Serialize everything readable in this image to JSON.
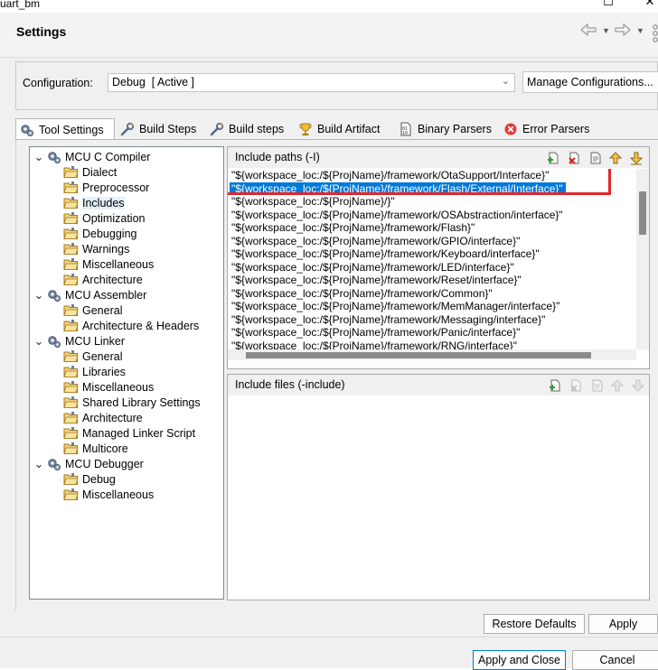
{
  "window": {
    "title": "uart_bm",
    "maximize_glyph": "☐",
    "close_glyph": "✕"
  },
  "header": {
    "title": "Settings",
    "back_icon": "back-arrow-icon",
    "forward_icon": "forward-arrow-icon",
    "menu_icon": "view-menu-icon"
  },
  "configuration": {
    "label": "Configuration:",
    "value": "Debug  [ Active ]",
    "manage_button": "Manage Configurations..."
  },
  "tabs": [
    {
      "label": "Tool Settings",
      "icon": "gears-icon",
      "active": true
    },
    {
      "label": "Build Steps",
      "icon": "wrench-icon"
    },
    {
      "label": "Build steps",
      "icon": "wrench-icon"
    },
    {
      "label": "Build Artifact",
      "icon": "trophy-icon"
    },
    {
      "label": "Binary Parsers",
      "icon": "binary-file-icon"
    },
    {
      "label": "Error Parsers",
      "icon": "error-icon"
    }
  ],
  "tree": [
    {
      "label": "MCU C Compiler",
      "level": 0,
      "expanded": true,
      "icon": "gears-icon"
    },
    {
      "label": "Dialect",
      "level": 1,
      "icon": "folder-icon"
    },
    {
      "label": "Preprocessor",
      "level": 1,
      "icon": "folder-icon"
    },
    {
      "label": "Includes",
      "level": 1,
      "icon": "folder-icon",
      "selected": true
    },
    {
      "label": "Optimization",
      "level": 1,
      "icon": "folder-icon"
    },
    {
      "label": "Debugging",
      "level": 1,
      "icon": "folder-icon"
    },
    {
      "label": "Warnings",
      "level": 1,
      "icon": "folder-icon"
    },
    {
      "label": "Miscellaneous",
      "level": 1,
      "icon": "folder-icon"
    },
    {
      "label": "Architecture",
      "level": 1,
      "icon": "folder-icon"
    },
    {
      "label": "MCU Assembler",
      "level": 0,
      "expanded": true,
      "icon": "gears-icon"
    },
    {
      "label": "General",
      "level": 1,
      "icon": "folder-icon"
    },
    {
      "label": "Architecture & Headers",
      "level": 1,
      "icon": "folder-icon"
    },
    {
      "label": "MCU Linker",
      "level": 0,
      "expanded": true,
      "icon": "gears-icon"
    },
    {
      "label": "General",
      "level": 1,
      "icon": "folder-icon"
    },
    {
      "label": "Libraries",
      "level": 1,
      "icon": "folder-icon"
    },
    {
      "label": "Miscellaneous",
      "level": 1,
      "icon": "folder-icon"
    },
    {
      "label": "Shared Library Settings",
      "level": 1,
      "icon": "folder-icon"
    },
    {
      "label": "Architecture",
      "level": 1,
      "icon": "folder-icon"
    },
    {
      "label": "Managed Linker Script",
      "level": 1,
      "icon": "folder-icon"
    },
    {
      "label": "Multicore",
      "level": 1,
      "icon": "folder-icon"
    },
    {
      "label": "MCU Debugger",
      "level": 0,
      "expanded": true,
      "icon": "gears-icon"
    },
    {
      "label": "Debug",
      "level": 1,
      "icon": "folder-icon"
    },
    {
      "label": "Miscellaneous",
      "level": 1,
      "icon": "folder-icon"
    }
  ],
  "include_paths": {
    "title": "Include paths (-I)",
    "toolbar": [
      "add-icon",
      "delete-icon",
      "edit-icon",
      "move-up-icon",
      "move-down-icon"
    ],
    "items": [
      "\"${workspace_loc:/${ProjName}/framework/OtaSupport/Interface}\"",
      "\"${workspace_loc:/${ProjName}/framework/Flash/External/Interface}\"",
      "\"${workspace_loc:/${ProjName}/}\"",
      "\"${workspace_loc:/${ProjName}/framework/OSAbstraction/interface}\"",
      "\"${workspace_loc:/${ProjName}/framework/Flash}\"",
      "\"${workspace_loc:/${ProjName}/framework/GPIO/interface}\"",
      "\"${workspace_loc:/${ProjName}/framework/Keyboard/interface}\"",
      "\"${workspace_loc:/${ProjName}/framework/LED/interface}\"",
      "\"${workspace_loc:/${ProjName}/framework/Reset/interface}\"",
      "\"${workspace_loc:/${ProjName}/framework/Common}\"",
      "\"${workspace_loc:/${ProjName}/framework/MemManager/interface}\"",
      "\"${workspace_loc:/${ProjName}/framework/Messaging/interface}\"",
      "\"${workspace_loc:/${ProjName}/framework/Panic/interface}\"",
      "\"${workspace_loc:/${ProjName}/framework/RNG/interface}\""
    ],
    "selected_index": 1
  },
  "include_files": {
    "title": "Include files (-include)",
    "toolbar": [
      "add-icon",
      "delete-icon",
      "edit-icon",
      "move-up-icon",
      "move-down-icon"
    ],
    "items": []
  },
  "buttons": {
    "restore": "Restore Defaults",
    "apply": "Apply",
    "apply_close": "Apply and Close",
    "cancel": "Cancel"
  },
  "colors": {
    "selection": "#0078d7",
    "highlight_box": "#e3262d",
    "background": "#f0f0f0"
  }
}
